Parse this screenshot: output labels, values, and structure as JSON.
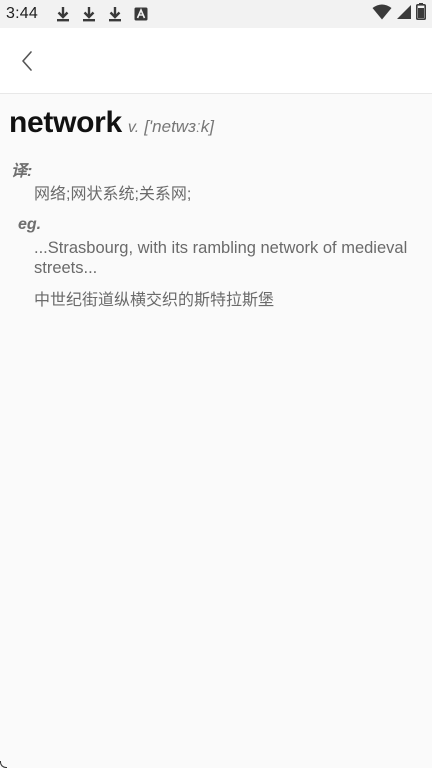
{
  "status_bar": {
    "time": "3:44",
    "notifications": [
      "download-icon",
      "download-icon",
      "download-icon",
      "translate-a-icon"
    ],
    "system_icons": [
      "wifi-icon",
      "signal-icon",
      "battery-icon"
    ]
  },
  "app_bar": {
    "back_icon": "chevron-left-icon"
  },
  "entry": {
    "word": "network",
    "part_of_speech": "v.",
    "phonetic": "['netwɜːk]",
    "translation_label": "译:",
    "translation": "网络;网状系统;关系网;",
    "example_label": "eg.",
    "example_en": "...Strasbourg, with its rambling network of medieval streets...",
    "example_zh": "中世纪街道纵横交织的斯特拉斯堡"
  },
  "colors": {
    "status_bar_bg": "#f2f2f2",
    "app_bar_bg": "#ffffff",
    "page_bg": "#fafafa",
    "headword": "#111111",
    "secondary_text": "#6a6a6a"
  }
}
